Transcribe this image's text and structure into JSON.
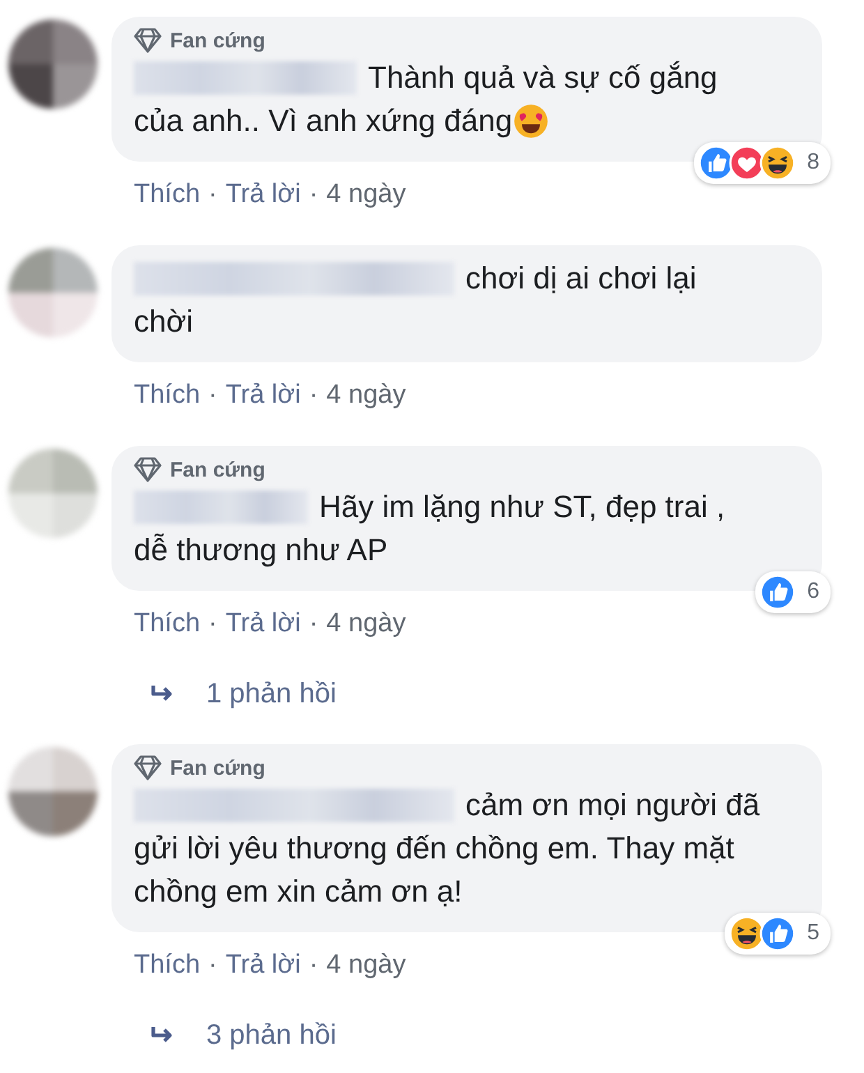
{
  "comments": [
    {
      "badge": "Fan cứng",
      "lines": [
        "Thành quả và sự cố gắng",
        "của anh.. Vì anh xứng đáng"
      ],
      "trailing_emoji": {
        "kind": "heart-eyes"
      },
      "reactions": [
        {
          "kind": "like"
        },
        {
          "kind": "love"
        },
        {
          "kind": "haha"
        }
      ],
      "reaction_count": "8",
      "actions": [
        {
          "kind": "link",
          "text": "Thích"
        },
        {
          "kind": "sep",
          "text": "·"
        },
        {
          "kind": "link",
          "text": "Trả lời"
        },
        {
          "kind": "sep",
          "text": "·"
        },
        {
          "kind": "time",
          "text": "4 ngày"
        }
      ]
    },
    {
      "lines": [
        "chơi dị ai chơi lại",
        "chời"
      ],
      "actions": [
        {
          "kind": "link",
          "text": "Thích"
        },
        {
          "kind": "sep",
          "text": "·"
        },
        {
          "kind": "link",
          "text": "Trả lời"
        },
        {
          "kind": "sep",
          "text": "·"
        },
        {
          "kind": "time",
          "text": "4 ngày"
        }
      ]
    },
    {
      "badge": "Fan cứng",
      "lines": [
        "Hãy im lặng như ST, đẹp trai ,",
        "dễ thương như AP"
      ],
      "reactions": [
        {
          "kind": "like"
        }
      ],
      "reaction_count": "6",
      "actions": [
        {
          "kind": "link",
          "text": "Thích"
        },
        {
          "kind": "sep",
          "text": "·"
        },
        {
          "kind": "link",
          "text": "Trả lời"
        },
        {
          "kind": "sep",
          "text": "·"
        },
        {
          "kind": "time",
          "text": "4 ngày"
        }
      ],
      "replies": "1 phản hồi"
    },
    {
      "badge": "Fan cứng",
      "lines": [
        "cảm ơn mọi người đã",
        "gửi lời yêu thương đến chồng em. Thay mặt",
        "chồng em xin cảm ơn ạ!"
      ],
      "reactions": [
        {
          "kind": "haha"
        },
        {
          "kind": "like"
        }
      ],
      "reaction_count": "5",
      "actions": [
        {
          "kind": "link",
          "text": "Thích"
        },
        {
          "kind": "sep",
          "text": "·"
        },
        {
          "kind": "link",
          "text": "Trả lời"
        },
        {
          "kind": "sep",
          "text": "·"
        },
        {
          "kind": "time",
          "text": "4 ngày"
        }
      ],
      "replies": "3 phản hồi"
    }
  ]
}
